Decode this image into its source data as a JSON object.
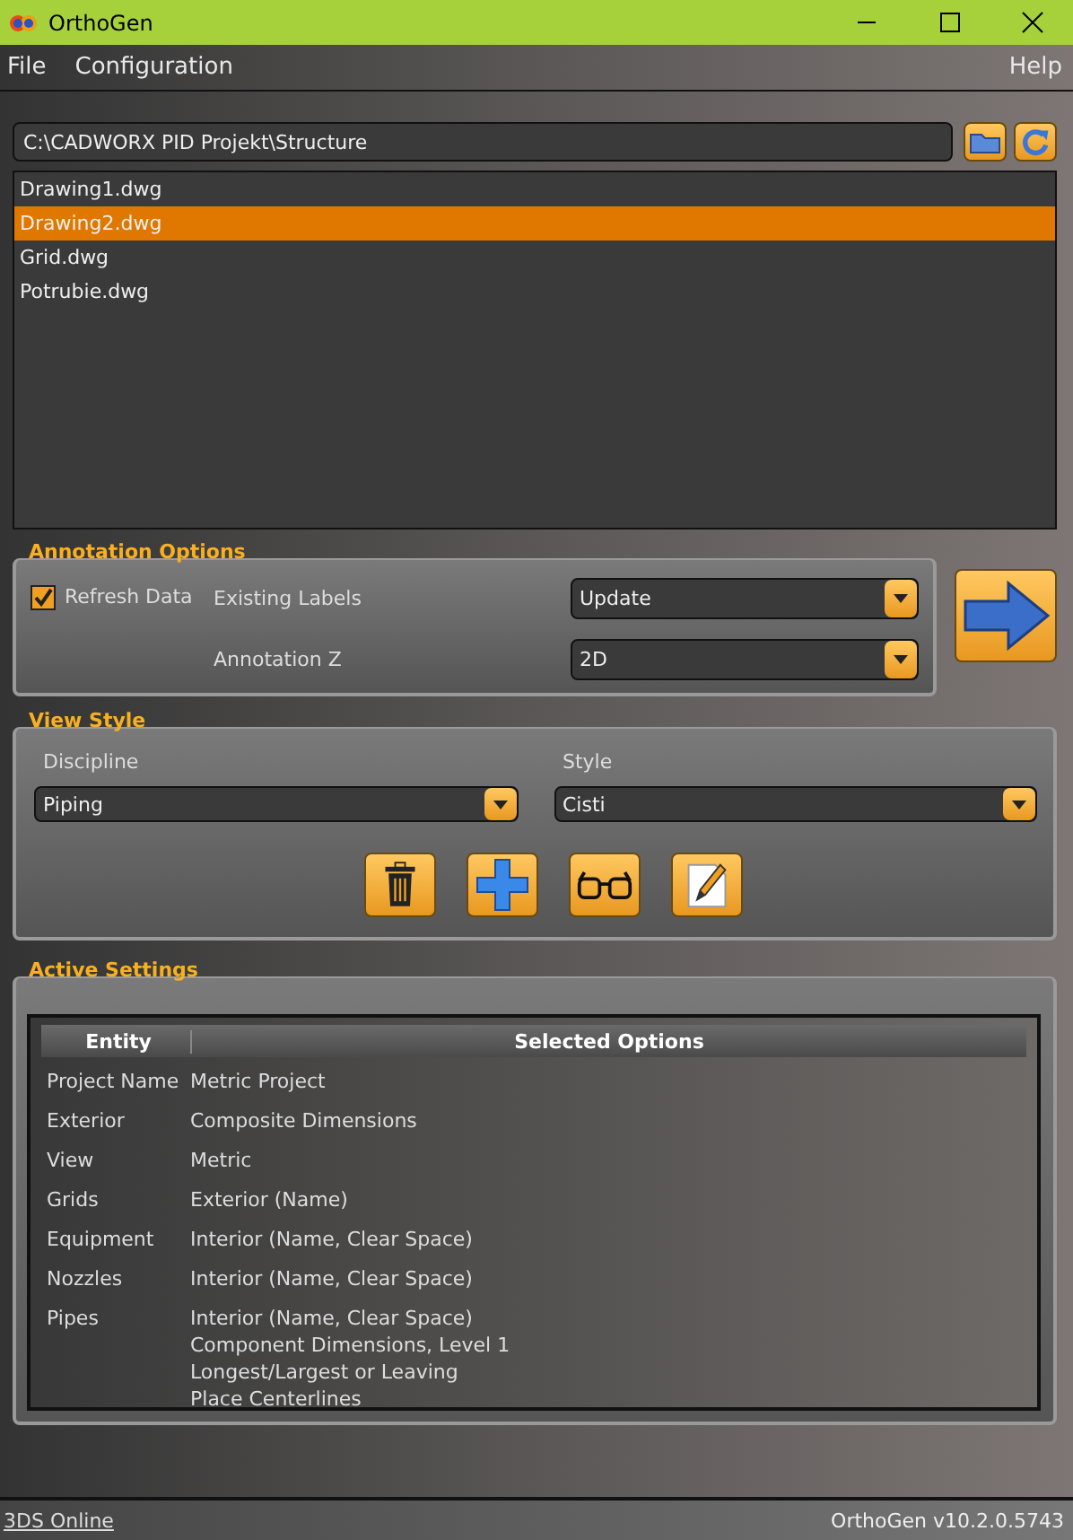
{
  "window": {
    "title": "OrthoGen"
  },
  "menu": [
    {
      "label": "File"
    },
    {
      "label": "Configuration"
    }
  ],
  "help": "Help",
  "path": {
    "value": "C:\\CADWORX PID Projekt\\Structure"
  },
  "files": [
    {
      "name": "Drawing1.dwg",
      "selected": false
    },
    {
      "name": "Drawing2.dwg",
      "selected": true
    },
    {
      "name": "Grid.dwg",
      "selected": false
    },
    {
      "name": "Potrubie.dwg",
      "selected": false
    }
  ],
  "annotation": {
    "title": "Annotation Options",
    "refresh": {
      "label": "Refresh Data",
      "checked": true
    },
    "fields": [
      {
        "label": "Existing Labels",
        "value": "Update"
      },
      {
        "label": "Annotation Z",
        "value": "2D"
      }
    ]
  },
  "view_style": {
    "title": "View Style",
    "fields": [
      {
        "label": "Discipline",
        "value": "Piping"
      },
      {
        "label": "Style",
        "value": "Cisti"
      }
    ],
    "buttons": [
      {
        "kind": "delete"
      },
      {
        "kind": "add"
      },
      {
        "kind": "view"
      },
      {
        "kind": "edit"
      }
    ]
  },
  "active": {
    "title": "Active Settings",
    "columns": [
      "Entity",
      "Selected Options"
    ],
    "rows": [
      {
        "entity": "Project Name",
        "options": [
          "Metric Project"
        ]
      },
      {
        "entity": "Exterior",
        "options": [
          "Composite Dimensions"
        ]
      },
      {
        "entity": "View",
        "options": [
          "Metric"
        ]
      },
      {
        "entity": "Grids",
        "options": [
          "Exterior (Name)"
        ]
      },
      {
        "entity": "Equipment",
        "options": [
          "Interior (Name, Clear Space)"
        ]
      },
      {
        "entity": "Nozzles",
        "options": [
          "Interior (Name, Clear Space)"
        ]
      },
      {
        "entity": "Pipes",
        "options": [
          "Interior (Name, Clear Space)",
          "Component Dimensions, Level 1",
          "Longest/Largest or Leaving",
          "Place Centerlines"
        ]
      }
    ]
  },
  "status_bar": {
    "link": "3DS Online",
    "version": "OrthoGen v10.2.0.5743"
  }
}
